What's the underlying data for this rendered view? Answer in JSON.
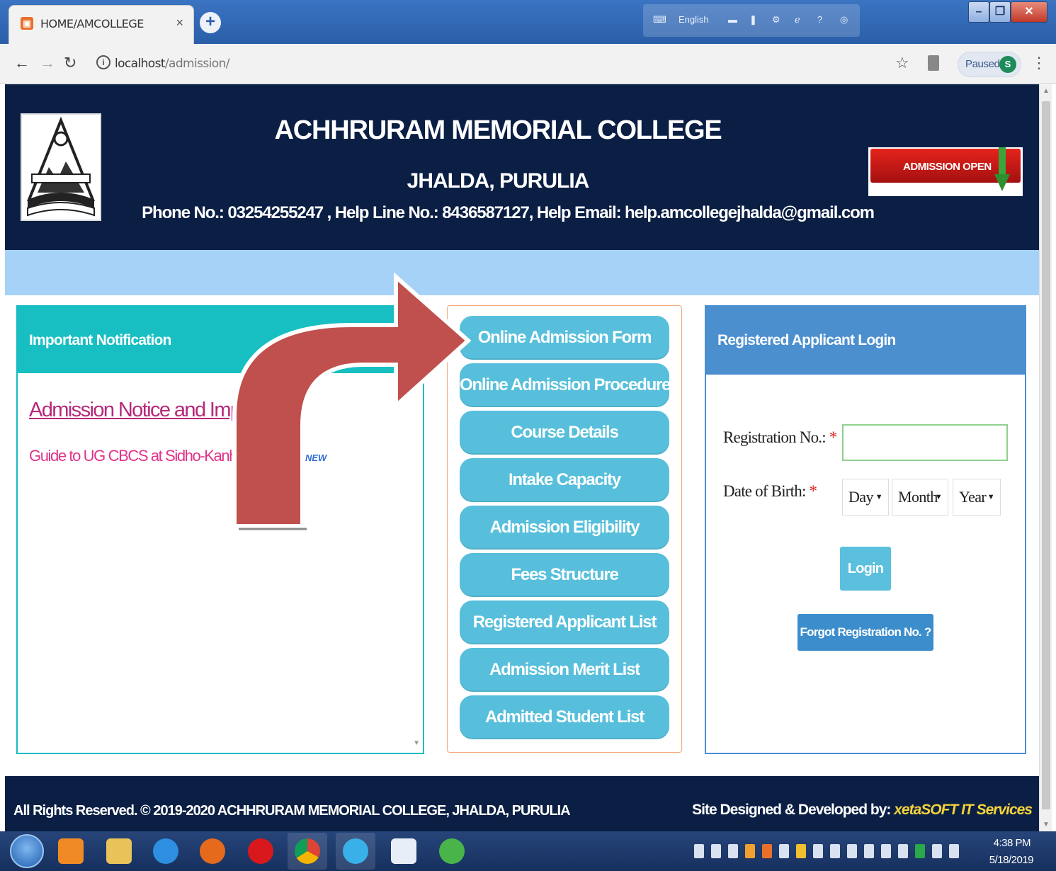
{
  "browser": {
    "tab_title": "HOME/AMCOLLEGE",
    "tab_close": "×",
    "new_tab": "+",
    "url_host": "localhost",
    "url_path": "/admission/",
    "profile_status": "Paused",
    "profile_initial": "S",
    "lang_indicator": "English",
    "icons": [
      "back-arrow-icon",
      "forward-arrow-icon",
      "reload-icon",
      "info-icon",
      "star-icon",
      "menu-dots-icon"
    ]
  },
  "header": {
    "college_name": "ACHHRURAM MEMORIAL COLLEGE",
    "place": "JHALDA, PURULIA",
    "contact": "Phone No.: 03254255247 , Help Line No.: 8436587127, Help Email: help.amcollegejhalda@gmail.com",
    "badge": "ADMISSION OPEN"
  },
  "notification": {
    "title": "Important Notification",
    "notice_link": "Admission Notice and Important",
    "guide_link": "Guide to UG CBCS at Sidho-Kanho-Birs",
    "new_badge": "NEW"
  },
  "menu": [
    "Online Admission Form",
    "Online Admission Procedure",
    "Course Details",
    "Intake Capacity",
    "Admission Eligibility",
    "Fees Structure",
    "Registered Applicant List",
    "Admission Merit List",
    "Admitted Student List"
  ],
  "login": {
    "title": "Registered Applicant Login",
    "reg_label": "Registration No.:",
    "dob_label": "Date of Birth:",
    "required_mark": "*",
    "reg_value": "",
    "day": "Day",
    "month": "Month",
    "year": "Year",
    "login_button": "Login",
    "forgot_button": "Forgot Registration No. ?"
  },
  "footer": {
    "copyright": "All Rights Reserved. © 2019-2020 ACHHRURAM MEMORIAL COLLEGE, JHALDA, PURULIA",
    "designed_by": "Site Designed & Developed by: ",
    "developer": "xetaSOFT IT Services"
  },
  "taskbar": {
    "time": "4:38 PM",
    "date": "5/18/2019"
  },
  "colors": {
    "header_bg": "#0b1f44",
    "strip": "#a6d2f7",
    "notify_teal": "#18bfc2",
    "menu_button": "#57bfdb",
    "login_head": "#4b8fcf",
    "link_magenta": "#b6287a",
    "arrow_red": "#c0504d"
  }
}
